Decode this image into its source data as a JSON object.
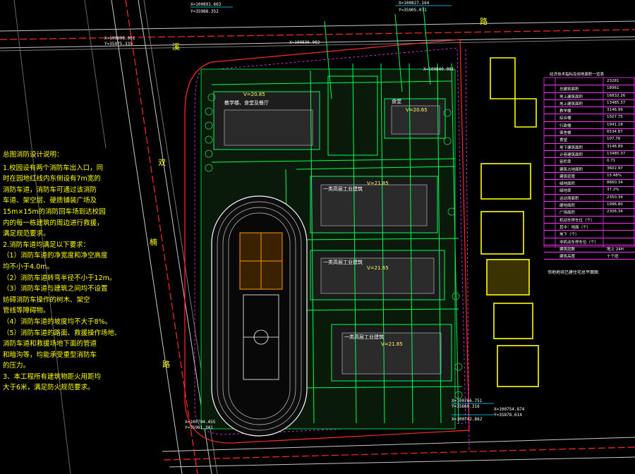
{
  "notes": {
    "title": "总图消防设计说明：",
    "lines": [
      "1.校园设有两个消防车出入口，同",
      "   时在园地红线内东侧设有7m宽的",
      "   消防车道，消防车可通过该消防",
      "   车道、架空层、硬质铺装广场及",
      "   15m×15m的消防回车场到达校园",
      "   内的每一栋建筑的周边进行救援，",
      "   满足规范要求。",
      "2.消防车道均满足以下要求：",
      "（1）消防车道的净宽度和净空高度",
      "       均不小于4.0m。",
      "（2）消防车道转弯半径不小于12m。",
      "（3）消防车道与建筑之间均不设置",
      "       妨碍消防车操作的树木、架空",
      "       管线等障碍物。",
      "（4）消防车道的坡度均不大于8%。",
      "（5）消防车道的路面、救援操作场地、",
      "       消防车道和救援场地下面的管道",
      "       和暗沟等，均能承受重型消防车",
      "       的压力。",
      "3、本工程所有建筑物距火用距均",
      "   大于6米，满足防火规范要求。"
    ]
  },
  "road_labels": {
    "west": [
      "双",
      "楠",
      "路"
    ],
    "north": [
      "溪",
      "路"
    ]
  },
  "site_labels": {
    "east_building": "邻地地块已建住宅总平面图"
  },
  "table": {
    "title": "经济技术指标及用地面积一览表",
    "rows": [
      {
        "k": "",
        "v": "23281"
      },
      {
        "k": "总建筑面积",
        "v": "18961"
      },
      {
        "k": "地上建筑面积",
        "v": "16832.26"
      },
      {
        "k": "地上建筑面积",
        "v": "13485.37"
      },
      {
        "k": "教学楼",
        "v": "3146.99"
      },
      {
        "k": "综合楼",
        "v": "1507.75"
      },
      {
        "k": "行政楼",
        "v": "1941.18"
      },
      {
        "k": "宿舍楼",
        "v": "6534.87"
      },
      {
        "k": "食堂",
        "v": "107.76"
      },
      {
        "k": "地下建筑面积",
        "v": "3146.89"
      },
      {
        "k": "计容建筑面积",
        "v": "13485.37"
      },
      {
        "k": "容积率",
        "v": "0.71"
      },
      {
        "k": "建筑占地面积",
        "v": "3602.97"
      },
      {
        "k": "建筑密度",
        "v": "15.48%"
      },
      {
        "k": "绿地面积",
        "v": "8660.34"
      },
      {
        "k": "绿地率",
        "v": "37.2%"
      },
      {
        "k": "运动场面积",
        "v": "2350.34"
      },
      {
        "k": "硬地面积",
        "v": "1996.80"
      },
      {
        "k": "广场面积",
        "v": "2306.34"
      },
      {
        "k": "机动车停车位（个）",
        "v": ""
      },
      {
        "k": "其中：地面（个）",
        "v": ""
      },
      {
        "k": "地下（个）",
        "v": ""
      },
      {
        "k": "非机动车停车位（个）",
        "v": ""
      },
      {
        "k": "建筑层数",
        "v": "地上 24H"
      },
      {
        "k": "建筑高度",
        "v": "十个班"
      }
    ]
  },
  "buildings": [
    {
      "label": "教学楼、食堂及餐厅",
      "level": "V=20.85"
    },
    {
      "label": "食堂",
      "level": "V=20.65"
    },
    {
      "label": "一类高层工业建筑",
      "level": "V=21.85"
    },
    {
      "label": "一类高层工业建筑",
      "level": "V=21.65"
    },
    {
      "label": "一类高层工业建筑",
      "level": "V=21.85"
    }
  ],
  "coords": [
    "X=100891.663",
    "Y=35988.352",
    "X=100827.164",
    "Y=35905.071",
    "X=100898.061",
    "Y=35975.335",
    "X=100836.082",
    "X=100840.081",
    "X=100794.455",
    "Y=35981.341",
    "X=100766.751",
    "Y=35669.316",
    "X=100754.874",
    "Y=35878.614",
    "X=100742.862"
  ],
  "colors": {
    "background": "#000000",
    "boundary": "#ff3030",
    "road": "#d0d0d0",
    "building": "#00ff66",
    "note_text": "#ffff00",
    "table_line": "#ff2fff",
    "track": "#ffffff",
    "court": "#ff9900",
    "neighbor": "#ffff00"
  }
}
